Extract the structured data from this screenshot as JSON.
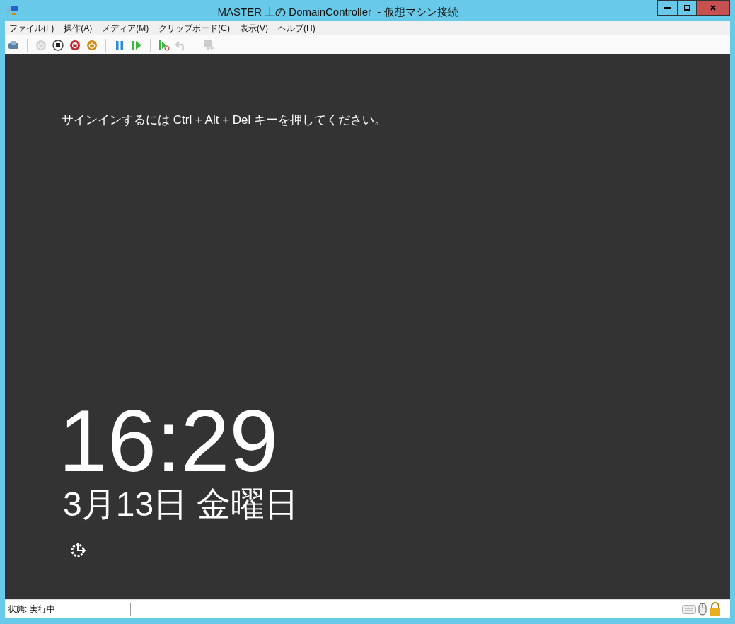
{
  "window": {
    "title": "MASTER 上の DomainController  - 仮想マシン接続"
  },
  "menu": [
    "ファイル(F)",
    "操作(A)",
    "メディア(M)",
    "クリップボード(C)",
    "表示(V)",
    "ヘルプ(H)"
  ],
  "toolbar": [
    {
      "kind": "ctrl-alt-del",
      "disabled": false
    },
    {
      "kind": "sep"
    },
    {
      "kind": "start",
      "disabled": true
    },
    {
      "kind": "stop",
      "disabled": false
    },
    {
      "kind": "shutdown",
      "disabled": false
    },
    {
      "kind": "save",
      "disabled": false
    },
    {
      "kind": "sep"
    },
    {
      "kind": "pause",
      "disabled": false
    },
    {
      "kind": "resume",
      "disabled": false
    },
    {
      "kind": "sep"
    },
    {
      "kind": "checkpoint",
      "disabled": false
    },
    {
      "kind": "revert",
      "disabled": true
    },
    {
      "kind": "sep"
    },
    {
      "kind": "enhanced",
      "disabled": true
    }
  ],
  "screen": {
    "prompt": "サインインするには Ctrl + Alt + Del キーを押してください。",
    "time": "16:29",
    "date": "3月13日 金曜日"
  },
  "status_bar": {
    "status": "状態: 実行中"
  }
}
